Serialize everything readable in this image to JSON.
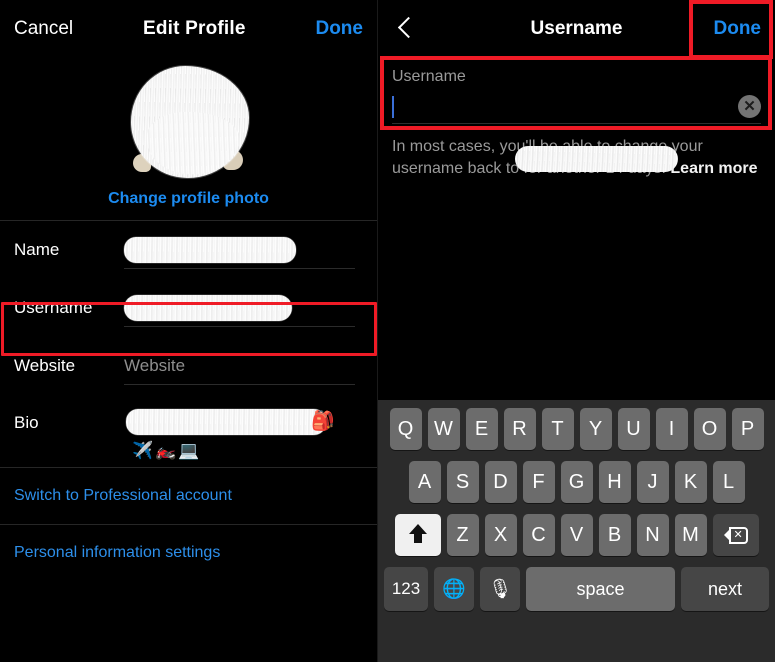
{
  "left": {
    "navbar": {
      "cancel_label": "Cancel",
      "title": "Edit Profile",
      "done_label": "Done"
    },
    "avatar": {
      "change_photo_label": "Change profile photo",
      "redacted": true
    },
    "fields": [
      {
        "label": "Name",
        "value": "",
        "redacted": true,
        "placeholder": ""
      },
      {
        "label": "Username",
        "value": "",
        "redacted": true,
        "placeholder": ""
      },
      {
        "label": "Website",
        "value": "",
        "redacted": false,
        "placeholder": "Website"
      },
      {
        "label": "Bio",
        "value": "",
        "redacted": true,
        "placeholder": ""
      }
    ],
    "bio_emojis": "✈️🏍️💻",
    "bio_trailing_emoji": "🎒",
    "links": [
      {
        "label": "Switch to Professional account"
      },
      {
        "label": "Personal information settings"
      }
    ]
  },
  "right": {
    "navbar": {
      "back_icon": "chevron-left-icon",
      "title": "Username",
      "done_label": "Done"
    },
    "username_field": {
      "label": "Username",
      "value": "",
      "clear_icon": "✕",
      "caret_visible": true
    },
    "helper": {
      "prefix": "In most cases, you'll be able to change your username back to",
      "redacted_value": "",
      "suffix": "for another 14 days.",
      "link_label": "Learn more"
    }
  },
  "keyboard": {
    "row1": [
      "Q",
      "W",
      "E",
      "R",
      "T",
      "Y",
      "U",
      "I",
      "O",
      "P"
    ],
    "row2": [
      "A",
      "S",
      "D",
      "F",
      "G",
      "H",
      "J",
      "K",
      "L"
    ],
    "row3": [
      "Z",
      "X",
      "C",
      "V",
      "B",
      "N",
      "M"
    ],
    "shift_label": "shift-key",
    "backspace_label": "backspace-key",
    "numbers_label": "123",
    "globe_label": "🌐",
    "mic_label": "🎙",
    "space_label": "space",
    "next_label": "next",
    "shift_active": true
  },
  "annotations": {
    "color": "#ef1b26",
    "boxes": [
      "left-username-row",
      "right-done-button",
      "right-username-input"
    ]
  }
}
